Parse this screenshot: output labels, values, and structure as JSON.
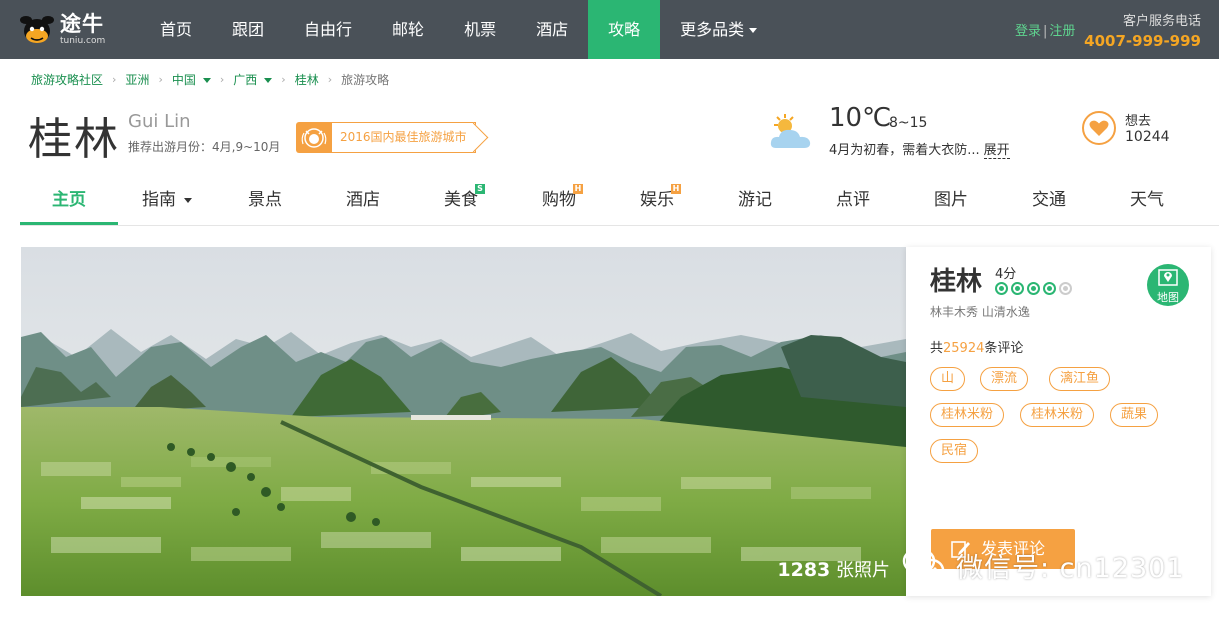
{
  "header": {
    "logo": {
      "name_cn": "途牛",
      "name_en": "tuniu.com"
    },
    "nav": [
      {
        "label": "首页"
      },
      {
        "label": "跟团"
      },
      {
        "label": "自由行"
      },
      {
        "label": "邮轮"
      },
      {
        "label": "机票"
      },
      {
        "label": "酒店"
      },
      {
        "label": "攻略",
        "active": true
      },
      {
        "label": "更多品类",
        "dropdown": true
      }
    ],
    "login_label": "登录",
    "register_label": "注册",
    "service_label": "客户服务电话",
    "service_phone": "4007-999-999"
  },
  "breadcrumb": [
    {
      "label": "旅游攻略社区"
    },
    {
      "label": "亚洲"
    },
    {
      "label": "中国",
      "dropdown": true
    },
    {
      "label": "广西",
      "dropdown": true
    },
    {
      "label": "桂林"
    },
    {
      "label": "旅游攻略"
    }
  ],
  "destination": {
    "name": "桂林",
    "name_en": "Gui Lin",
    "best_months": "推荐出游月份：4月,9~10月",
    "award": "2016国内最佳旅游城市"
  },
  "weather": {
    "icon": "sun-cloud-icon",
    "temp": "10℃",
    "range": "8~15",
    "desc": "4月为初春，需着大衣防...",
    "more_label": "展开"
  },
  "want": {
    "icon": "heart-icon",
    "label": "想去",
    "count": "10244"
  },
  "tabs": [
    {
      "label": "主页",
      "active": true
    },
    {
      "label": "指南",
      "dropdown": true
    },
    {
      "label": "景点"
    },
    {
      "label": "酒店"
    },
    {
      "label": "美食",
      "badge": "S"
    },
    {
      "label": "购物",
      "badge": "H"
    },
    {
      "label": "娱乐",
      "badge": "H"
    },
    {
      "label": "游记"
    },
    {
      "label": "点评"
    },
    {
      "label": "图片"
    },
    {
      "label": "交通"
    },
    {
      "label": "天气"
    }
  ],
  "hero": {
    "photo_count": "1283",
    "photo_unit": "张照片"
  },
  "card": {
    "name": "桂林",
    "score": "4分",
    "rating": 4,
    "rating_max": 5,
    "slogan": "林丰木秀 山清水逸",
    "map_label": "地图",
    "reviews_prefix": "共",
    "reviews_count": "25924",
    "reviews_suffix": "条评论",
    "tags": [
      "山",
      "漂流",
      "漓江鱼",
      "桂林米粉",
      "桂林米粉",
      "蔬果",
      "民宿"
    ],
    "review_button": "发表评论"
  },
  "watermark": {
    "text": "微信号: cn12301"
  },
  "colors": {
    "topbar": "#4a5158",
    "brand_green": "#2bb673",
    "accent_orange": "#f5a142",
    "phone_orange": "#f5a623"
  }
}
